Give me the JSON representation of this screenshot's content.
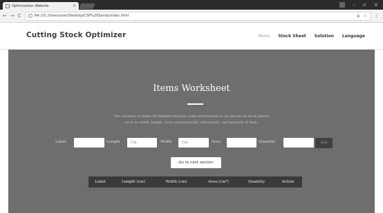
{
  "browser": {
    "tab_title": "Optimization Website",
    "tab_close": "×",
    "address": "file:///C:/Users/user/Desktop/CSP%20Sandy/index.html",
    "window_min": "–",
    "window_max": "▫",
    "window_close": "×",
    "nav_back": "←",
    "nav_forward": "→",
    "nav_reload": "C",
    "zoom_icon": "⊕",
    "star_icon": "☆",
    "menu_icon": "⋮"
  },
  "site": {
    "brand": "Cutting Stock Optimizer",
    "nav": [
      {
        "label": "Items",
        "active": true
      },
      {
        "label": "Stock Sheet",
        "active": false
      },
      {
        "label": "Solution",
        "active": false
      },
      {
        "label": "Language",
        "active": false
      }
    ]
  },
  "hero": {
    "title": "Items Worksheet",
    "description_line1": "The columns in Items Worksheet requires some information to be placed on stock sheets",
    "description_line2": "such as width, length, area (automatically calculated), and quantity of item."
  },
  "form": {
    "label_label": "Label",
    "length_label": "Length",
    "length_placeholder": "Cm",
    "width_label": "Width",
    "width_placeholder": "Cm",
    "area_label": "Area",
    "quantity_label": "Quantity",
    "add_button": "Add"
  },
  "next_button": "Go to next section",
  "table": {
    "headers": [
      "Label",
      "Length (cm)",
      "Width (cm)",
      "Area (cm²)",
      "Quantity",
      "Action"
    ]
  }
}
